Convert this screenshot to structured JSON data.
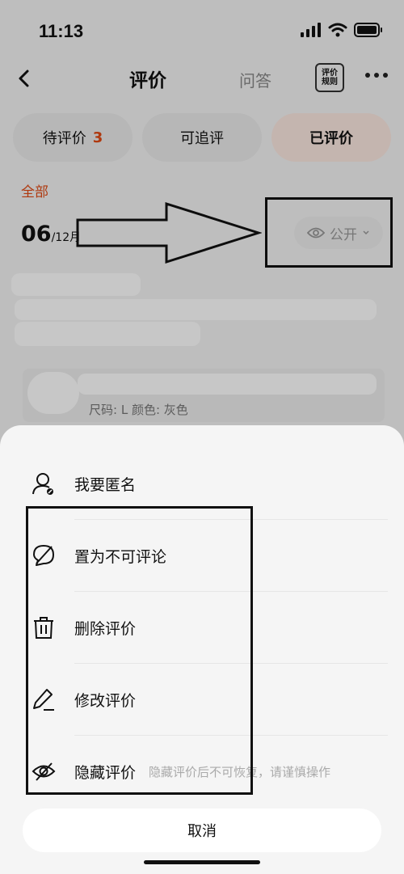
{
  "status": {
    "time": "11:13"
  },
  "nav": {
    "title": "评价",
    "qa_label": "问答",
    "rules_label": "评价规则"
  },
  "tabs": [
    {
      "label": "待评价",
      "count": "3"
    },
    {
      "label": "可追评"
    },
    {
      "label": "已评价"
    }
  ],
  "filter": {
    "all_label": "全部"
  },
  "review": {
    "day": "06",
    "month_suffix": "/12月",
    "visibility_label": "公开",
    "product_spec": "尺码: L  颜色: 灰色"
  },
  "sheet": {
    "items": [
      {
        "icon": "anonymous-user-icon",
        "label": "我要匿名"
      },
      {
        "icon": "no-comment-icon",
        "label": "置为不可评论"
      },
      {
        "icon": "trash-icon",
        "label": "删除评价"
      },
      {
        "icon": "edit-pencil-icon",
        "label": "修改评价"
      },
      {
        "icon": "eye-off-icon",
        "label": "隐藏评价",
        "hint": "隐藏评价后不可恢复，请谨慎操作"
      }
    ],
    "cancel_label": "取消"
  },
  "colors": {
    "accent": "#e04a14",
    "active_tab_bg": "#fbe8e1"
  }
}
